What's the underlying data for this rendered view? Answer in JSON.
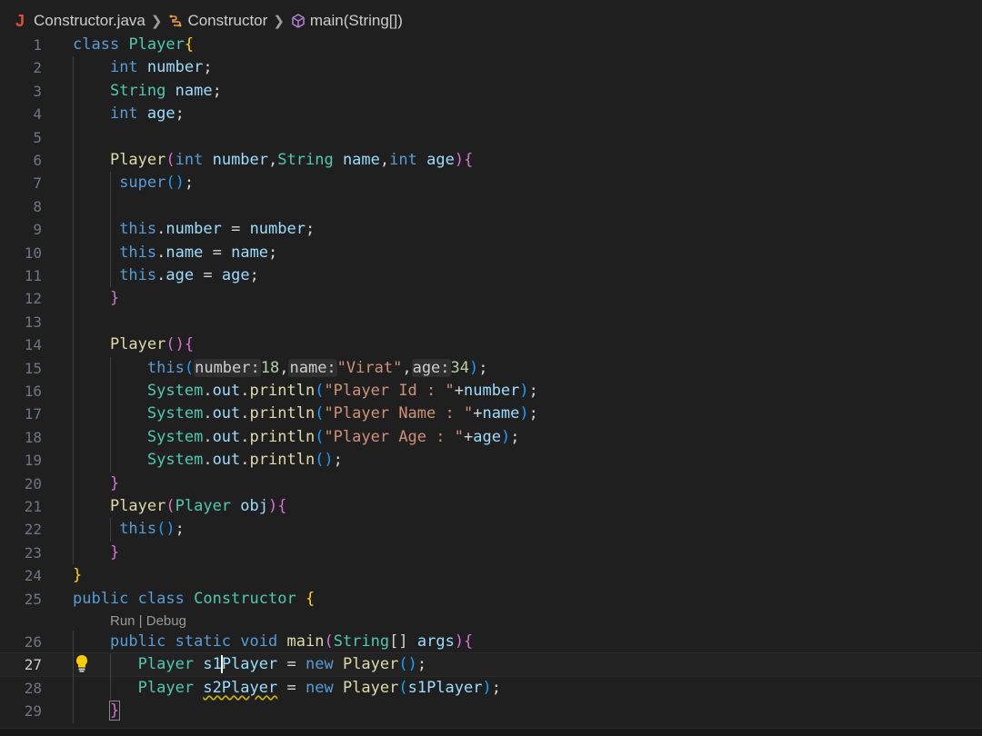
{
  "breadcrumb": {
    "file_icon": "J",
    "file": "Constructor.java",
    "class_icon": "class-symbol-icon",
    "class_name": "Constructor",
    "method_icon": "method-cube-icon",
    "method": "main(String[])"
  },
  "codelens": "Run | Debug",
  "lines": [
    {
      "n": "1",
      "cur": false,
      "html": "<span class='k'>class</span> <span class='t'>Player</span><span class='b1'>{</span>"
    },
    {
      "n": "2",
      "cur": false,
      "html": "    <span class='k'>int</span> <span class='v'>number</span><span class='p'>;</span>"
    },
    {
      "n": "3",
      "cur": false,
      "html": "    <span class='t'>String</span> <span class='v'>name</span><span class='p'>;</span>"
    },
    {
      "n": "4",
      "cur": false,
      "html": "    <span class='k'>int</span> <span class='v'>age</span><span class='p'>;</span>"
    },
    {
      "n": "5",
      "cur": false,
      "html": ""
    },
    {
      "n": "6",
      "cur": false,
      "html": "    <span class='f'>Player</span><span class='b2'>(</span><span class='k'>int</span> <span class='v'>number</span><span class='p'>,</span><span class='t'>String</span> <span class='v'>name</span><span class='p'>,</span><span class='k'>int</span> <span class='v'>age</span><span class='b2'>){</span>"
    },
    {
      "n": "7",
      "cur": false,
      "html": "     <span class='k'>super</span><span class='b3'>()</span><span class='p'>;</span>"
    },
    {
      "n": "8",
      "cur": false,
      "html": ""
    },
    {
      "n": "9",
      "cur": false,
      "html": "     <span class='k'>this</span><span class='p'>.</span><span class='v'>number</span> <span class='p'>=</span> <span class='v'>number</span><span class='p'>;</span>"
    },
    {
      "n": "10",
      "cur": false,
      "html": "     <span class='k'>this</span><span class='p'>.</span><span class='v'>name</span> <span class='p'>=</span> <span class='v'>name</span><span class='p'>;</span>"
    },
    {
      "n": "11",
      "cur": false,
      "html": "     <span class='k'>this</span><span class='p'>.</span><span class='v'>age</span> <span class='p'>=</span> <span class='v'>age</span><span class='p'>;</span>"
    },
    {
      "n": "12",
      "cur": false,
      "html": "    <span class='b2'>}</span>"
    },
    {
      "n": "13",
      "cur": false,
      "html": ""
    },
    {
      "n": "14",
      "cur": false,
      "html": "    <span class='f'>Player</span><span class='b2'>(){</span>"
    },
    {
      "n": "15",
      "cur": false,
      "html": "        <span class='k'>this</span><span class='b3'>(</span><span class='hint'>number:</span><span class='n'>18</span><span class='p'>,</span><span class='hint'>name:</span><span class='s'>\"Virat\"</span><span class='p'>,</span><span class='hint'>age:</span><span class='n'>34</span><span class='b3'>)</span><span class='p'>;</span>"
    },
    {
      "n": "16",
      "cur": false,
      "html": "        <span class='t'>System</span><span class='p'>.</span><span class='v'>out</span><span class='p'>.</span><span class='f'>println</span><span class='b3'>(</span><span class='s'>\"Player Id : \"</span><span class='p'>+</span><span class='v'>number</span><span class='b3'>)</span><span class='p'>;</span>"
    },
    {
      "n": "17",
      "cur": false,
      "html": "        <span class='t'>System</span><span class='p'>.</span><span class='v'>out</span><span class='p'>.</span><span class='f'>println</span><span class='b3'>(</span><span class='s'>\"Player Name : \"</span><span class='p'>+</span><span class='v'>name</span><span class='b3'>)</span><span class='p'>;</span>"
    },
    {
      "n": "18",
      "cur": false,
      "html": "        <span class='t'>System</span><span class='p'>.</span><span class='v'>out</span><span class='p'>.</span><span class='f'>println</span><span class='b3'>(</span><span class='s'>\"Player Age : \"</span><span class='p'>+</span><span class='v'>age</span><span class='b3'>)</span><span class='p'>;</span>"
    },
    {
      "n": "19",
      "cur": false,
      "html": "        <span class='t'>System</span><span class='p'>.</span><span class='v'>out</span><span class='p'>.</span><span class='f'>println</span><span class='b3'>()</span><span class='p'>;</span>"
    },
    {
      "n": "20",
      "cur": false,
      "html": "    <span class='b2'>}</span>"
    },
    {
      "n": "21",
      "cur": false,
      "html": "    <span class='f'>Player</span><span class='b2'>(</span><span class='t'>Player</span> <span class='v'>obj</span><span class='b2'>){</span>"
    },
    {
      "n": "22",
      "cur": false,
      "html": "     <span class='k'>this</span><span class='b3'>()</span><span class='p'>;</span>"
    },
    {
      "n": "23",
      "cur": false,
      "html": "    <span class='b2'>}</span>"
    },
    {
      "n": "24",
      "cur": false,
      "html": "<span class='b1'>}</span>"
    },
    {
      "n": "25",
      "cur": false,
      "html": "<span class='k'>public</span> <span class='k'>class</span> <span class='t'>Constructor</span> <span class='b1'>{</span>"
    },
    {
      "n": "26",
      "cur": false,
      "html": "    <span class='k'>public</span> <span class='k'>static</span> <span class='k'>void</span> <span class='f'>main</span><span class='b2'>(</span><span class='t'>String</span><span class='p'>[]</span> <span class='v'>args</span><span class='b2'>){</span>"
    },
    {
      "n": "27",
      "cur": true,
      "html": "       <span class='t'>Player</span> <span class='v'>s1<span class='cursor'></span>Player</span> <span class='p'>=</span> <span class='k'>new</span> <span class='f'>Player</span><span class='b3'>()</span><span class='p'>;</span>"
    },
    {
      "n": "28",
      "cur": false,
      "html": "       <span class='t'>Player</span> <span class='v squig'>s2Player</span> <span class='p'>=</span> <span class='k'>new</span> <span class='f'>Player</span><span class='b3'>(</span><span class='v'>s1Player</span><span class='b3'>)</span><span class='p'>;</span>"
    },
    {
      "n": "29",
      "cur": false,
      "html": "    <span class='b2' style='outline:1px solid #888;'>}</span>"
    }
  ]
}
